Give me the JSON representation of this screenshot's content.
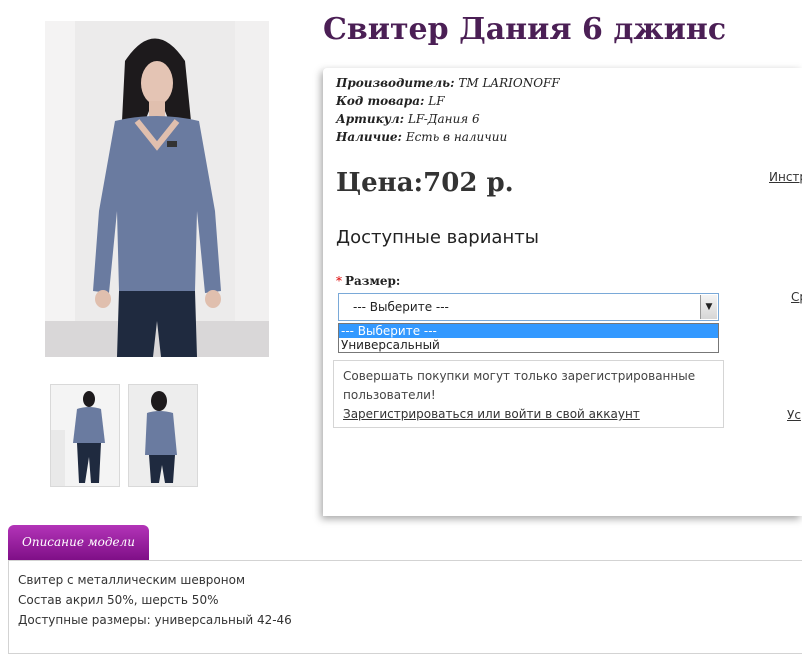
{
  "product": {
    "title": "Свитер Дания 6 джинс",
    "manufacturer_label": "Производитель:",
    "manufacturer_value": "TM LARIONOFF",
    "code_label": "Код товара:",
    "code_value": "LF",
    "article_label": "Артикул:",
    "article_value": "LF-Дания 6",
    "stock_label": "Наличие:",
    "stock_value": "Есть в наличии",
    "price": "Цена:702 р."
  },
  "side_links": {
    "link1": "Инстр",
    "link2": "Ср",
    "link3": "Ус"
  },
  "options": {
    "title": "Доступные варианты",
    "size_label": "Размер:",
    "required_mark": "*",
    "selected_value": "--- Выберите ---",
    "items": [
      "--- Выберите ---",
      "Универсальный"
    ]
  },
  "notice": {
    "text": "Совершать покупки могут только зарегистрированные пользователи!",
    "link": "Зарегистрироваться или войти в свой аккаунт"
  },
  "description": {
    "tab_label": "Описание модели",
    "lines": [
      "Свитер с металлическим шевроном",
      "Состав акрил 50%, шерсть 50%",
      "Доступные размеры: универсальный 42-46"
    ]
  },
  "colors": {
    "title": "#4b1f55",
    "tab": "#9b1fa3",
    "select_highlight": "#3399ff"
  }
}
